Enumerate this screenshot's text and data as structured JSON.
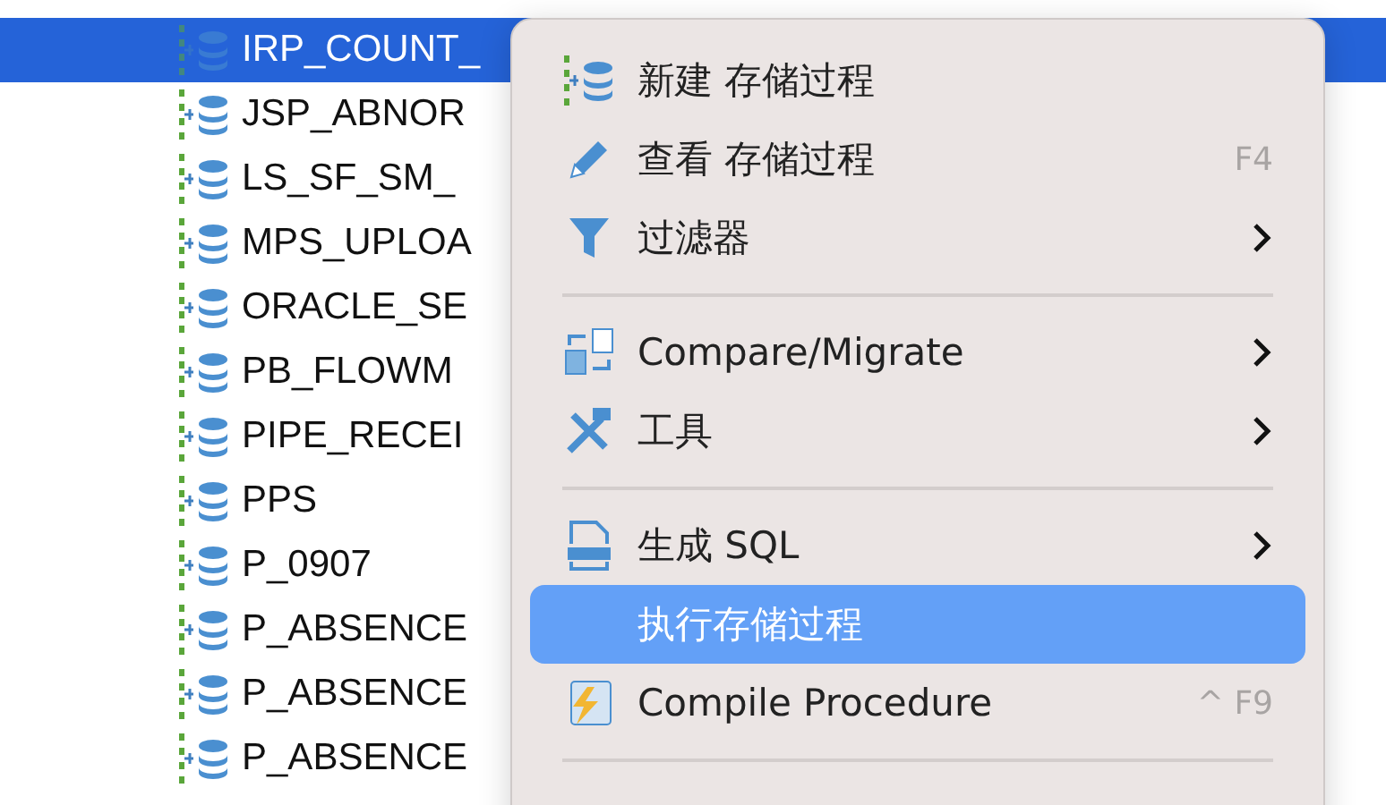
{
  "tree": {
    "items": [
      {
        "label": "IRP_COUNT_",
        "selected": true
      },
      {
        "label": "JSP_ABNOR",
        "selected": false
      },
      {
        "label": "LS_SF_SM_",
        "selected": false
      },
      {
        "label": "MPS_UPLOA",
        "selected": false
      },
      {
        "label": "ORACLE_SE",
        "selected": false
      },
      {
        "label": "PB_FLOWM",
        "selected": false
      },
      {
        "label": "PIPE_RECEI",
        "selected": false
      },
      {
        "label": "PPS",
        "selected": false
      },
      {
        "label": "P_0907",
        "selected": false
      },
      {
        "label": "P_ABSENCE",
        "selected": false
      },
      {
        "label": "P_ABSENCE",
        "selected": false
      },
      {
        "label": "P_ABSENCE",
        "selected": false
      }
    ]
  },
  "context_menu": {
    "items": [
      {
        "kind": "item",
        "label": "新建 存储过程",
        "selected": false
      },
      {
        "kind": "item",
        "label": "查看 存储过程",
        "shortcut": "F4",
        "selected": false
      },
      {
        "kind": "item",
        "label": "过滤器",
        "submenu": true,
        "selected": false
      },
      {
        "kind": "separator"
      },
      {
        "kind": "item",
        "label": "Compare/Migrate",
        "submenu": true,
        "selected": false
      },
      {
        "kind": "item",
        "label": "工具",
        "submenu": true,
        "selected": false
      },
      {
        "kind": "separator"
      },
      {
        "kind": "item",
        "label": "生成 SQL",
        "submenu": true,
        "selected": false
      },
      {
        "kind": "item",
        "label": "执行存储过程",
        "selected": true
      },
      {
        "kind": "item",
        "label": "Compile Procedure",
        "shortcut": "^ F9",
        "selected": false
      },
      {
        "kind": "separator"
      }
    ]
  }
}
